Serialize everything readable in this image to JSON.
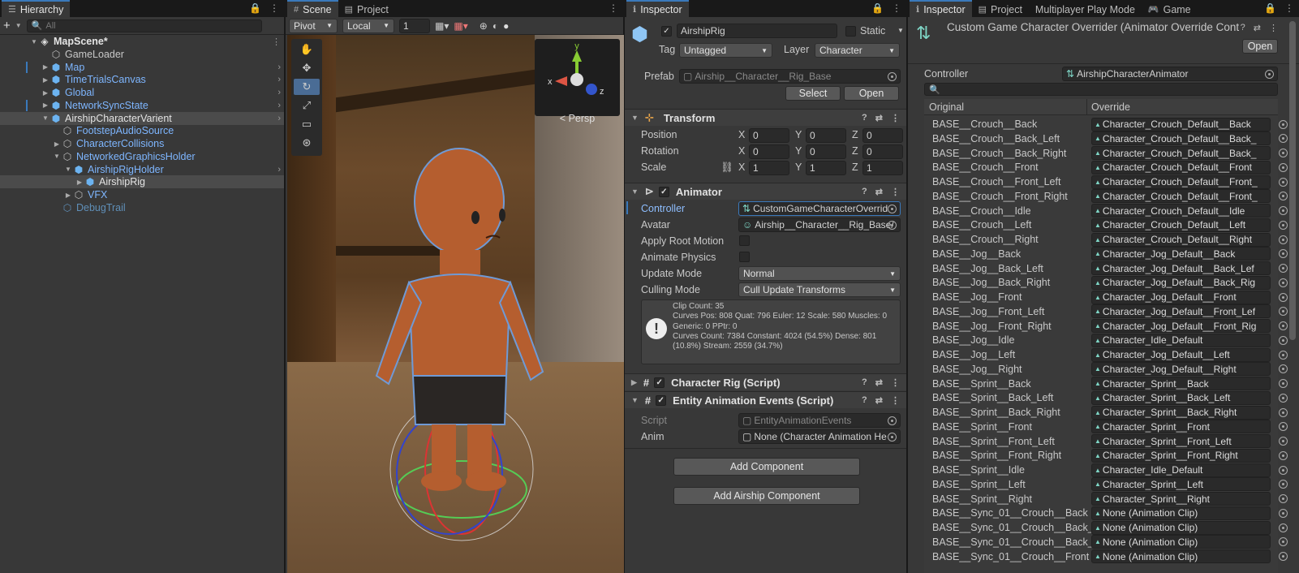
{
  "hierarchy": {
    "tab": "Hierarchy",
    "search_placeholder": "All",
    "items": [
      {
        "label": "MapScene*",
        "bold": true
      },
      {
        "label": "GameLoader"
      },
      {
        "label": "Map"
      },
      {
        "label": "TimeTrialsCanvas"
      },
      {
        "label": "Global"
      },
      {
        "label": "NetworkSyncState"
      },
      {
        "label": "AirshipCharacterVarient"
      },
      {
        "label": "FootstepAudioSource"
      },
      {
        "label": "CharacterCollisions"
      },
      {
        "label": "NetworkedGraphicsHolder"
      },
      {
        "label": "AirshipRigHolder"
      },
      {
        "label": "AirshipRig"
      },
      {
        "label": "VFX"
      },
      {
        "label": "DebugTrail"
      }
    ]
  },
  "scene": {
    "tabs": [
      "Scene",
      "Project"
    ],
    "pivot": "Pivot",
    "local": "Local",
    "grid_value": "1",
    "persp": "Persp",
    "axis_x": "x",
    "axis_y": "y",
    "axis_z": "z"
  },
  "inspector": {
    "tab": "Inspector",
    "object_name": "AirshipRig",
    "static_label": "Static",
    "tag_label": "Tag",
    "tag_value": "Untagged",
    "layer_label": "Layer",
    "layer_value": "Character",
    "prefab_label": "Prefab",
    "prefab_value": "Airship__Character__Rig_Base",
    "select_btn": "Select",
    "open_btn": "Open",
    "transform": {
      "title": "Transform",
      "position_label": "Position",
      "rotation_label": "Rotation",
      "scale_label": "Scale",
      "axes": [
        "X",
        "Y",
        "Z"
      ],
      "position": [
        "0",
        "0",
        "0"
      ],
      "rotation": [
        "0",
        "0",
        "0"
      ],
      "scale": [
        "1",
        "1",
        "1"
      ]
    },
    "animator": {
      "title": "Animator",
      "controller_label": "Controller",
      "controller_value": "CustomGameCharacterOverrid",
      "avatar_label": "Avatar",
      "avatar_value": "Airship__Character__Rig_Base/",
      "apply_root_motion": "Apply Root Motion",
      "animate_physics": "Animate Physics",
      "update_mode_label": "Update Mode",
      "update_mode_value": "Normal",
      "culling_mode_label": "Culling Mode",
      "culling_mode_value": "Cull Update Transforms",
      "info": [
        "Clip Count: 35",
        "Curves Pos: 808 Quat: 796 Euler: 12 Scale: 580 Muscles: 0",
        "Generic: 0 PPtr: 0",
        "Curves Count: 7384 Constant: 4024 (54.5%) Dense: 801",
        "(10.8%) Stream: 2559 (34.7%)"
      ]
    },
    "character_rig": "Character Rig (Script)",
    "entity_events": {
      "title": "Entity Animation Events (Script)",
      "script_label": "Script",
      "script_value": "EntityAnimationEvents",
      "anim_label": "Anim",
      "anim_value": "None (Character Animation He"
    },
    "add_component": "Add Component",
    "add_airship_component": "Add Airship Component"
  },
  "right": {
    "tabs": [
      "Inspector",
      "Project",
      "Multiplayer Play Mode",
      "Game"
    ],
    "title": "Custom Game Character Overrider (Animator Override Cont",
    "open_btn": "Open",
    "controller_label": "Controller",
    "controller_value": "AirshipCharacterAnimator",
    "col_original": "Original",
    "col_override": "Override",
    "rows": [
      [
        "BASE__Crouch__Back",
        "Character_Crouch_Default__Back"
      ],
      [
        "BASE__Crouch__Back_Left",
        "Character_Crouch_Default__Back_"
      ],
      [
        "BASE__Crouch__Back_Right",
        "Character_Crouch_Default__Back_"
      ],
      [
        "BASE__Crouch__Front",
        "Character_Crouch_Default__Front"
      ],
      [
        "BASE__Crouch__Front_Left",
        "Character_Crouch_Default__Front_"
      ],
      [
        "BASE__Crouch__Front_Right",
        "Character_Crouch_Default__Front_"
      ],
      [
        "BASE__Crouch__Idle",
        "Character_Crouch_Default__Idle"
      ],
      [
        "BASE__Crouch__Left",
        "Character_Crouch_Default__Left"
      ],
      [
        "BASE__Crouch__Right",
        "Character_Crouch_Default__Right"
      ],
      [
        "BASE__Jog__Back",
        "Character_Jog_Default__Back"
      ],
      [
        "BASE__Jog__Back_Left",
        "Character_Jog_Default__Back_Lef"
      ],
      [
        "BASE__Jog__Back_Right",
        "Character_Jog_Default__Back_Rig"
      ],
      [
        "BASE__Jog__Front",
        "Character_Jog_Default__Front"
      ],
      [
        "BASE__Jog__Front_Left",
        "Character_Jog_Default__Front_Lef"
      ],
      [
        "BASE__Jog__Front_Right",
        "Character_Jog_Default__Front_Rig"
      ],
      [
        "BASE__Jog__Idle",
        "Character_Idle_Default"
      ],
      [
        "BASE__Jog__Left",
        "Character_Jog_Default__Left"
      ],
      [
        "BASE__Jog__Right",
        "Character_Jog_Default__Right"
      ],
      [
        "BASE__Sprint__Back",
        "Character_Sprint__Back"
      ],
      [
        "BASE__Sprint__Back_Left",
        "Character_Sprint__Back_Left"
      ],
      [
        "BASE__Sprint__Back_Right",
        "Character_Sprint__Back_Right"
      ],
      [
        "BASE__Sprint__Front",
        "Character_Sprint__Front"
      ],
      [
        "BASE__Sprint__Front_Left",
        "Character_Sprint__Front_Left"
      ],
      [
        "BASE__Sprint__Front_Right",
        "Character_Sprint__Front_Right"
      ],
      [
        "BASE__Sprint__Idle",
        "Character_Idle_Default"
      ],
      [
        "BASE__Sprint__Left",
        "Character_Sprint__Left"
      ],
      [
        "BASE__Sprint__Right",
        "Character_Sprint__Right"
      ],
      [
        "BASE__Sync_01__Crouch__Back",
        "None (Animation Clip)"
      ],
      [
        "BASE__Sync_01__Crouch__Back_Lef",
        "None (Animation Clip)"
      ],
      [
        "BASE__Sync_01__Crouch__Back_Rig",
        "None (Animation Clip)"
      ],
      [
        "BASE__Sync_01__Crouch__Front",
        "None (Animation Clip)"
      ]
    ]
  }
}
